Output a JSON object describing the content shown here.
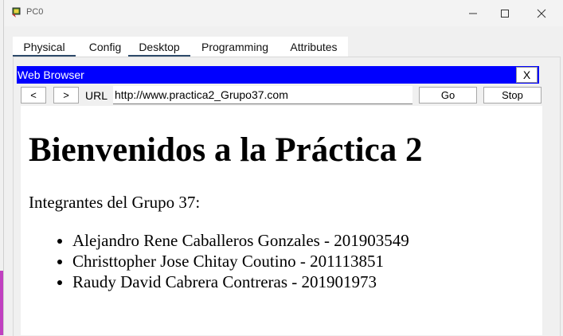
{
  "window": {
    "title": "PC0"
  },
  "tabs": [
    {
      "label": "Physical",
      "active": true
    },
    {
      "label": "Config",
      "active": false
    },
    {
      "label": "Desktop",
      "active": true
    },
    {
      "label": "Programming",
      "active": false
    },
    {
      "label": "Attributes",
      "active": false
    }
  ],
  "browser": {
    "title": "Web Browser",
    "close_label": "X",
    "back_label": "<",
    "forward_label": ">",
    "url_label": "URL",
    "url_value": "http://www.practica2_Grupo37.com",
    "go_label": "Go",
    "stop_label": "Stop",
    "title_bar_color": "#0000ff"
  },
  "page": {
    "heading": "Bienvenidos a la Práctica 2",
    "intro": "Integrantes del Grupo 37:",
    "members": [
      "Alejandro Rene Caballeros Gonzales - 201903549",
      "Christtopher Jose Chitay Coutino - 201113851",
      "Raudy David Cabrera Contreras - 201901973"
    ]
  }
}
